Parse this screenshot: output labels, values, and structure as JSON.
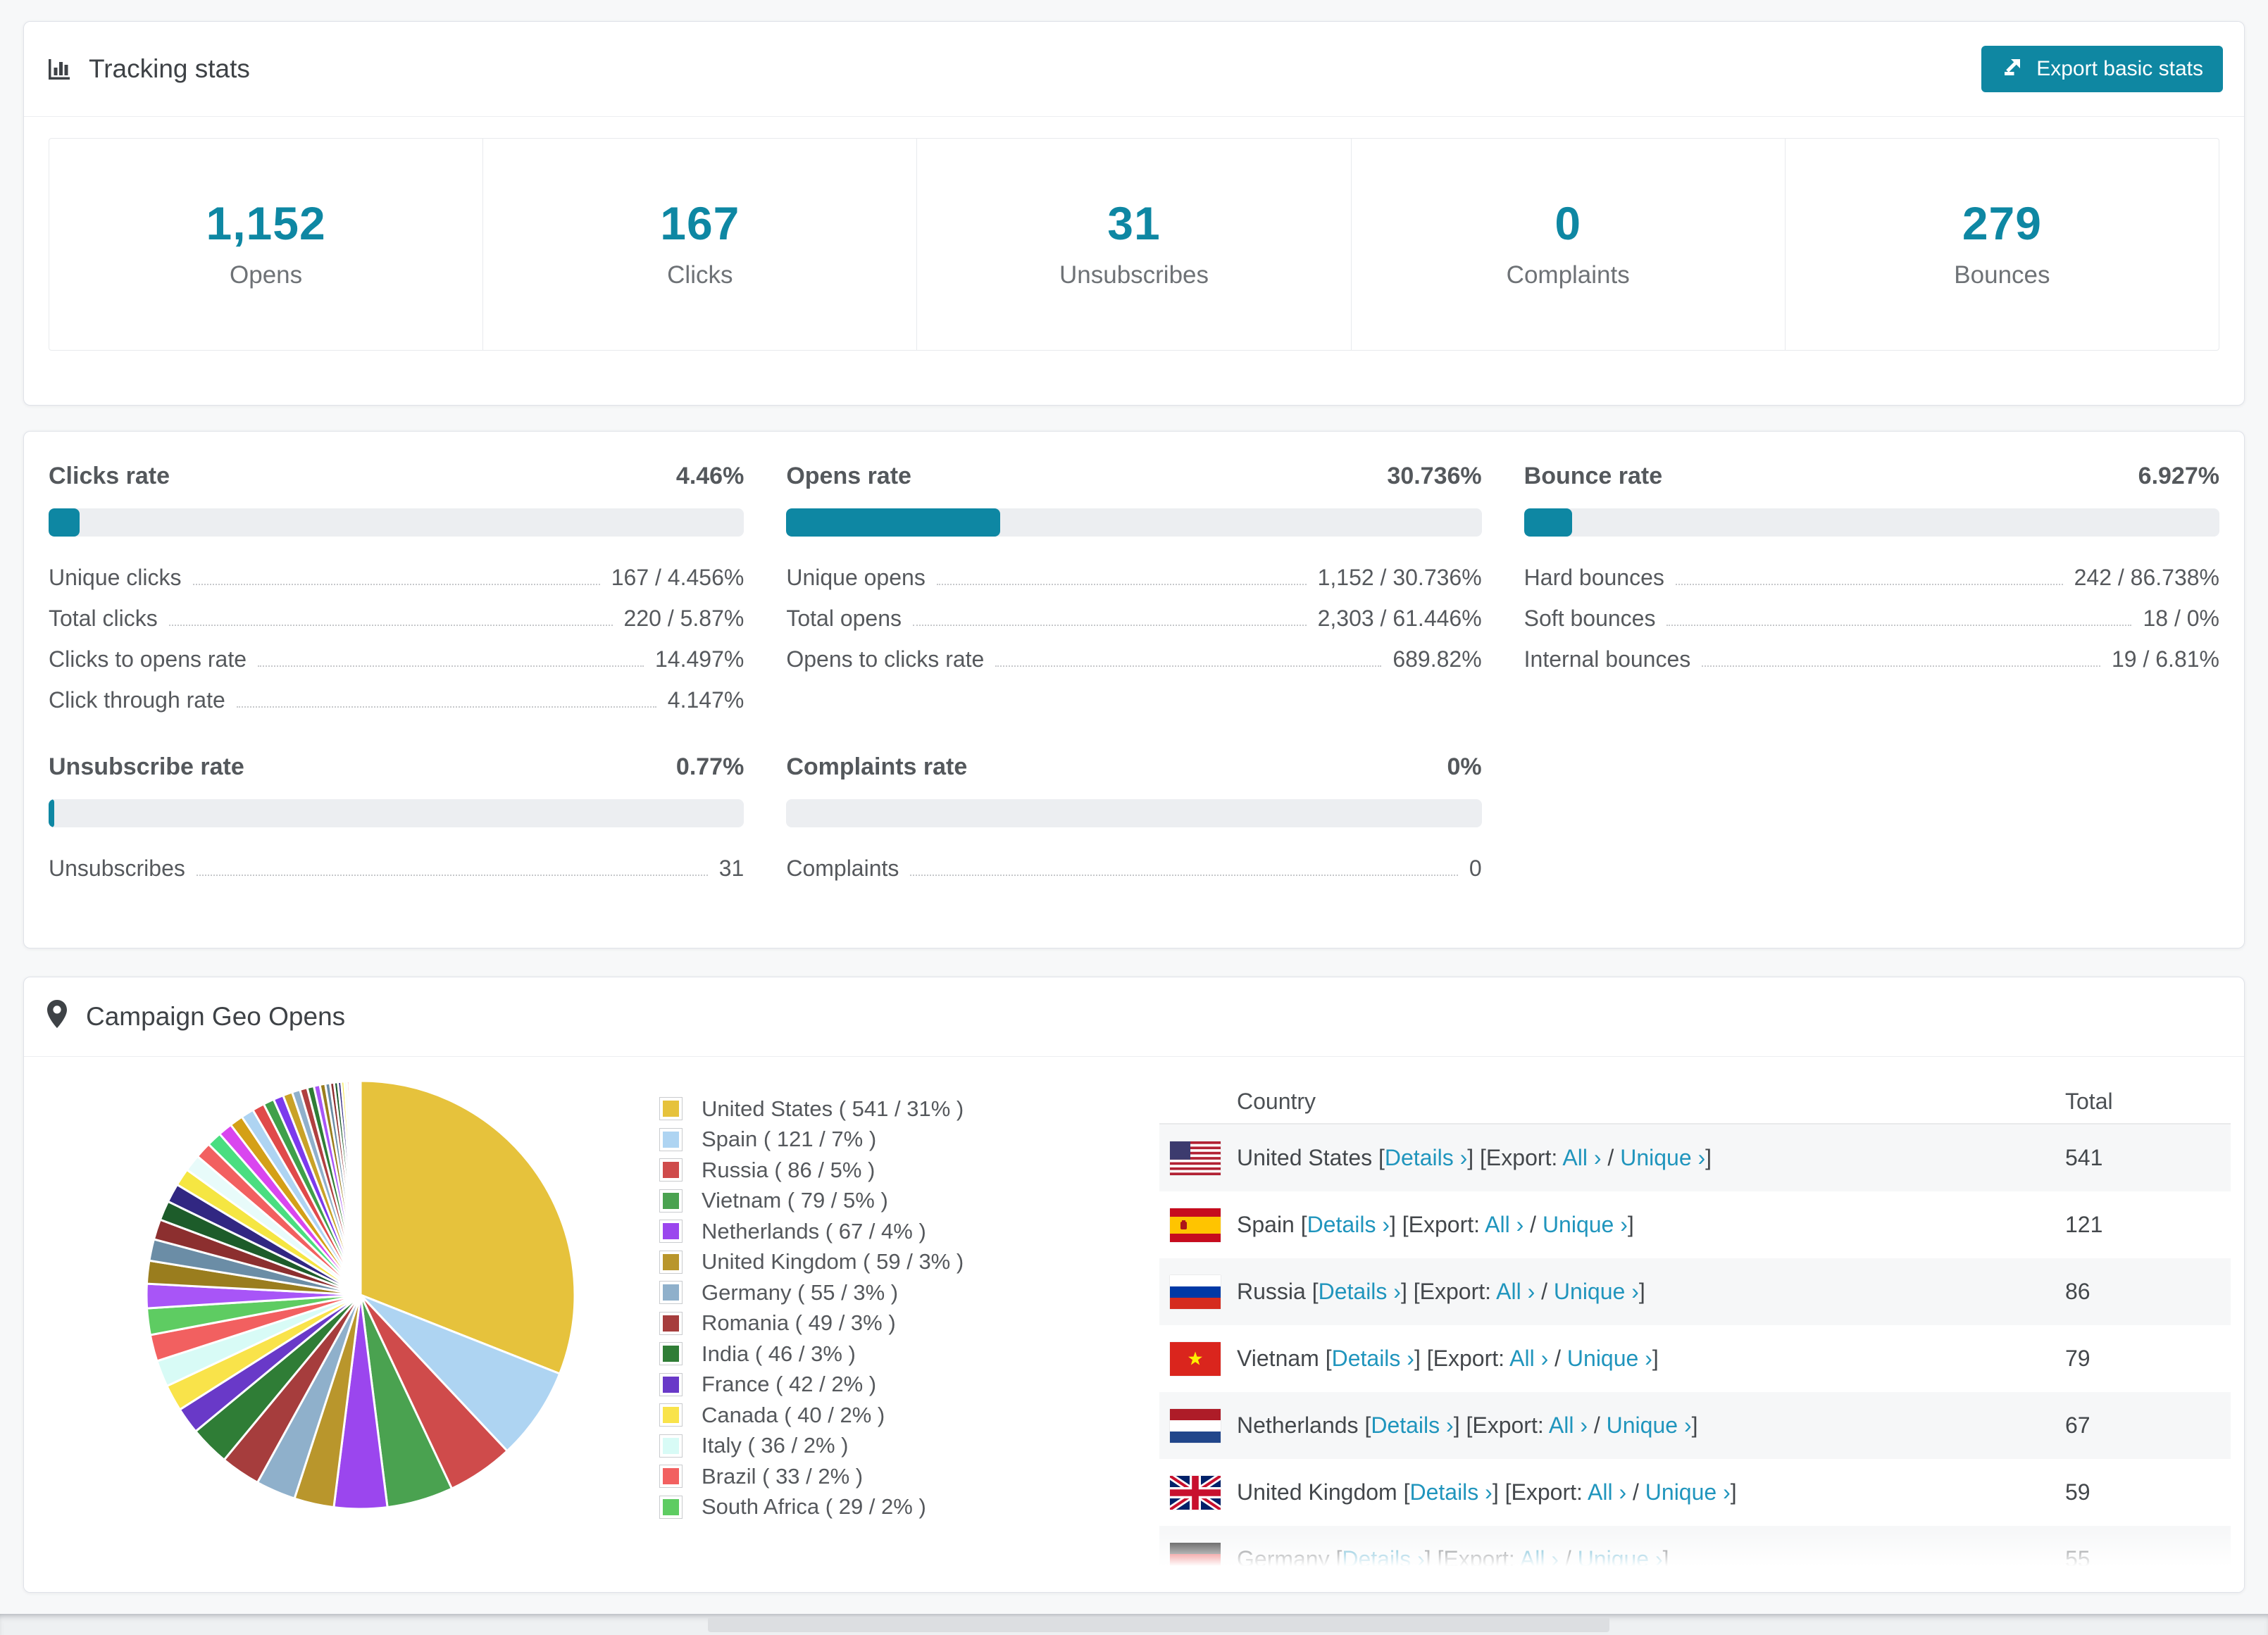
{
  "accent_color": "#0e87a3",
  "link_color": "#2095bd",
  "icons": {
    "title": "bar-chart-icon",
    "geo": "map-pin-icon",
    "button": "export-icon"
  },
  "tracking": {
    "title": "Tracking stats",
    "export_button": "Export basic stats",
    "stats": [
      {
        "value": "1,152",
        "label": "Opens"
      },
      {
        "value": "167",
        "label": "Clicks"
      },
      {
        "value": "31",
        "label": "Unsubscribes"
      },
      {
        "value": "0",
        "label": "Complaints"
      },
      {
        "value": "279",
        "label": "Bounces"
      }
    ]
  },
  "rates": [
    {
      "title": "Clicks rate",
      "value": "4.46%",
      "pct": 4.46,
      "rows": [
        [
          "Unique clicks",
          "167 / 4.456%"
        ],
        [
          "Total clicks",
          "220 / 5.87%"
        ],
        [
          "Clicks to opens rate",
          "14.497%"
        ],
        [
          "Click through rate",
          "4.147%"
        ]
      ]
    },
    {
      "title": "Opens rate",
      "value": "30.736%",
      "pct": 30.736,
      "rows": [
        [
          "Unique opens",
          "1,152 / 30.736%"
        ],
        [
          "Total opens",
          "2,303 / 61.446%"
        ],
        [
          "Opens to clicks rate",
          "689.82%"
        ]
      ]
    },
    {
      "title": "Bounce rate",
      "value": "6.927%",
      "pct": 6.927,
      "rows": [
        [
          "Hard bounces",
          "242 / 86.738%"
        ],
        [
          "Soft bounces",
          "18 / 0%"
        ],
        [
          "Internal bounces",
          "19 / 6.81%"
        ]
      ]
    },
    {
      "title": "Unsubscribe rate",
      "value": "0.77%",
      "pct": 0.77,
      "rows": [
        [
          "Unsubscribes",
          "31"
        ]
      ]
    },
    {
      "title": "Complaints rate",
      "value": "0%",
      "pct": 0,
      "rows": [
        [
          "Complaints",
          "0"
        ]
      ]
    }
  ],
  "geo": {
    "title": "Campaign Geo Opens",
    "table": {
      "headers": {
        "country": "Country",
        "total": "Total"
      },
      "visible_rows": 7,
      "last_row_partial": true,
      "flags": [
        "us",
        "es",
        "ru",
        "vn",
        "nl",
        "gb",
        "de"
      ],
      "links": {
        "details": "Details ›",
        "all": "All ›",
        "unique": "Unique ›",
        "export_prefix": "[Export: ",
        "bracket_open": "[",
        "bracket_close": "]",
        "slash": " / "
      }
    }
  },
  "chart_data": {
    "type": "pie",
    "title": "Campaign Geo Opens",
    "unit": "opens",
    "legend_position": "right",
    "start_angle_deg": 0,
    "direction": "clockwise",
    "labels": [
      "United States",
      "Spain",
      "Russia",
      "Vietnam",
      "Netherlands",
      "United Kingdom",
      "Germany",
      "Romania",
      "India",
      "France",
      "Canada",
      "Italy",
      "Brazil",
      "South Africa"
    ],
    "counts": [
      541,
      121,
      86,
      79,
      67,
      59,
      55,
      49,
      46,
      42,
      40,
      36,
      33,
      29
    ],
    "pcts": [
      31,
      7,
      5,
      5,
      4,
      3,
      3,
      3,
      3,
      2,
      2,
      2,
      2,
      2
    ],
    "colors": [
      "#e6c23c",
      "#aed4f2",
      "#cf4b4b",
      "#4aa250",
      "#9b46ee",
      "#b9962c",
      "#8fb0cb",
      "#a63d3d",
      "#2f7d36",
      "#6939c8",
      "#f9e34a",
      "#d8fbf6",
      "#f26060",
      "#5ecc62"
    ],
    "others_pct_total": 26,
    "others_weights": [
      1.8,
      1.7,
      1.6,
      1.5,
      1.45,
      1.4,
      1.3,
      1.25,
      1.2,
      1.1,
      1.05,
      1.0,
      0.95,
      0.9,
      0.8,
      0.75,
      0.7,
      0.6,
      0.55,
      0.5,
      0.45,
      0.4,
      0.35,
      0.3,
      0.28,
      0.25,
      0.22,
      0.2,
      0.17,
      0.15,
      0.12,
      0.1,
      0.09,
      0.08,
      0.07,
      0.06,
      0.05,
      0.04,
      0.04,
      0.03
    ],
    "others_palette": [
      "#a855f7",
      "#9a7d1e",
      "#6b8da6",
      "#8c2f2f",
      "#1d5c2a",
      "#312782",
      "#f5e642",
      "#e8fbfa",
      "#f26060",
      "#4ade80",
      "#d946ef",
      "#d4a017",
      "#aed4f2",
      "#e04a4a",
      "#3fa04a",
      "#7c3aed",
      "#c9a227",
      "#8fb0cb",
      "#b04040",
      "#2f7d36"
    ]
  }
}
